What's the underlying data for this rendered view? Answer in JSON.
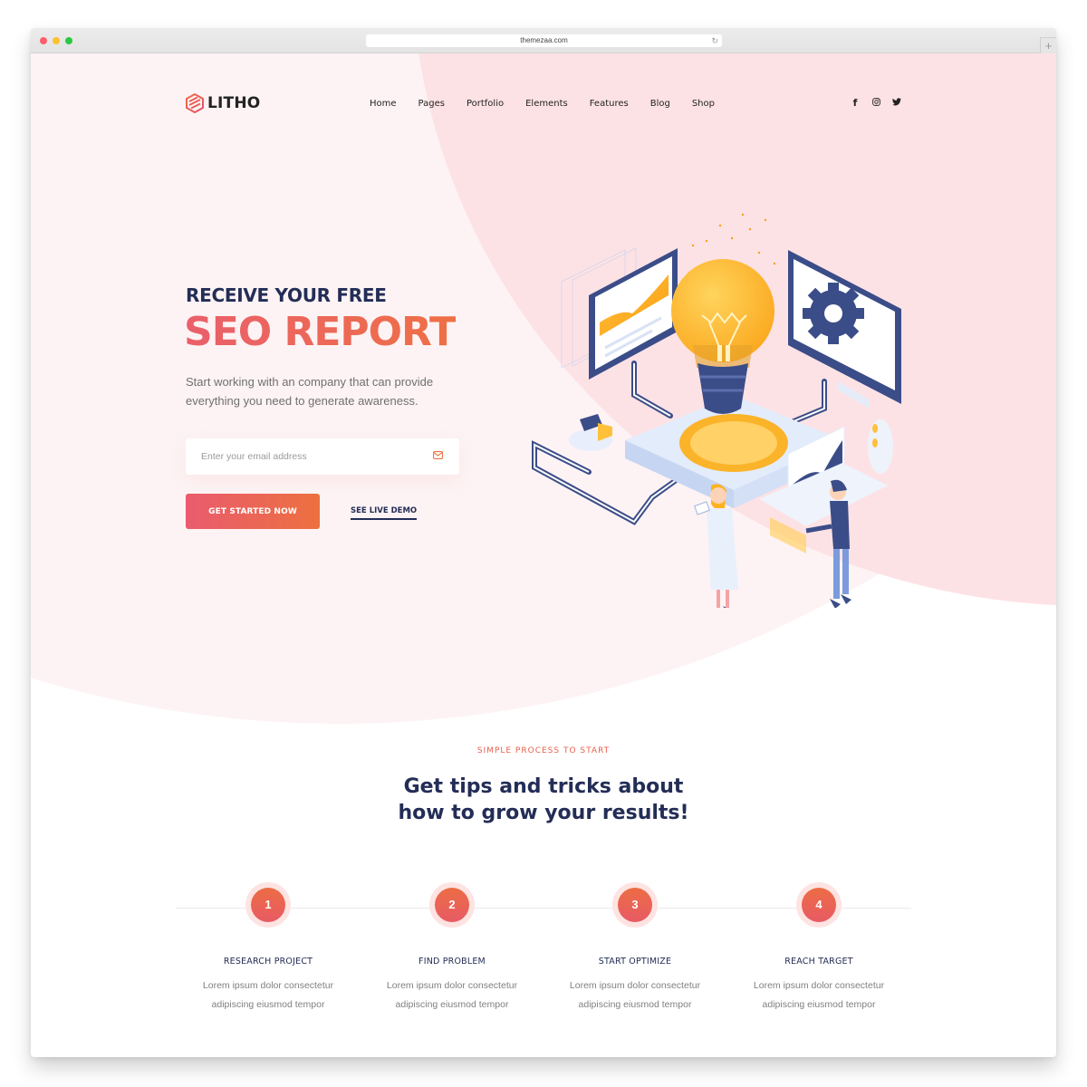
{
  "browser": {
    "url": "themezaa.com",
    "reload_icon": "↻",
    "new_tab_icon": "+"
  },
  "brand": {
    "name": "LITHO",
    "accent_start": "#ea5b6e",
    "accent_end": "#ec7040",
    "navy": "#232d56"
  },
  "nav": {
    "items": [
      {
        "label": "Home"
      },
      {
        "label": "Pages"
      },
      {
        "label": "Portfolio"
      },
      {
        "label": "Elements"
      },
      {
        "label": "Features"
      },
      {
        "label": "Blog"
      },
      {
        "label": "Shop"
      }
    ],
    "social": [
      {
        "name": "facebook-icon",
        "glyph": "f"
      },
      {
        "name": "instagram-icon",
        "glyph": "◎"
      },
      {
        "name": "twitter-icon",
        "glyph": "🐦"
      }
    ]
  },
  "hero": {
    "kicker": "RECEIVE YOUR FREE",
    "headline": "SEO REPORT",
    "lede": "Start working with an company that can provide everything you need to generate awareness.",
    "email_placeholder": "Enter your email address",
    "primary_button": "GET STARTED NOW",
    "secondary_link": "SEE LIVE DEMO",
    "illustration": "isometric lightbulb with monitors, gear, charts and two people"
  },
  "process": {
    "eyebrow": "SIMPLE PROCESS TO START",
    "title_line1": "Get tips and tricks about",
    "title_line2": "how to grow your results!",
    "steps": [
      {
        "number": "1",
        "title": "RESEARCH PROJECT",
        "line1": "Lorem ipsum dolor consectetur",
        "line2": "adipiscing eiusmod tempor"
      },
      {
        "number": "2",
        "title": "FIND PROBLEM",
        "line1": "Lorem ipsum dolor consectetur",
        "line2": "adipiscing eiusmod tempor"
      },
      {
        "number": "3",
        "title": "START OPTIMIZE",
        "line1": "Lorem ipsum dolor consectetur",
        "line2": "adipiscing eiusmod tempor"
      },
      {
        "number": "4",
        "title": "REACH TARGET",
        "line1": "Lorem ipsum dolor consectetur",
        "line2": "adipiscing eiusmod tempor"
      }
    ]
  }
}
